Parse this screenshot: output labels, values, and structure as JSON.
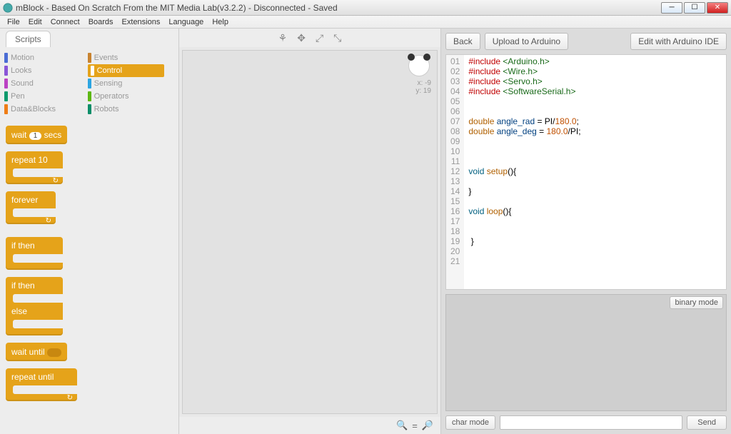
{
  "window": {
    "title": "mBlock - Based On Scratch From the MIT Media Lab(v3.2.2) - Disconnected - Saved"
  },
  "menu": [
    "File",
    "Edit",
    "Connect",
    "Boards",
    "Extensions",
    "Language",
    "Help"
  ],
  "tabs": {
    "scripts": "Scripts"
  },
  "categories": [
    {
      "name": "Motion",
      "color": "#4a6cd4"
    },
    {
      "name": "Events",
      "color": "#c88330"
    },
    {
      "name": "Looks",
      "color": "#8a55d7"
    },
    {
      "name": "Control",
      "color": "#e5a31a",
      "active": true
    },
    {
      "name": "Sound",
      "color": "#bb42c3"
    },
    {
      "name": "Sensing",
      "color": "#2ca5e2"
    },
    {
      "name": "Pen",
      "color": "#0e9a6c"
    },
    {
      "name": "Operators",
      "color": "#5cb712"
    },
    {
      "name": "Data&Blocks",
      "color": "#ee7d16"
    },
    {
      "name": "Robots",
      "color": "#0b8e69"
    }
  ],
  "blocks": {
    "wait_pre": "wait ",
    "wait_val": "1",
    "wait_post": " secs",
    "repeat_pre": "repeat ",
    "repeat_val": "10",
    "forever": "forever",
    "if_pre": "if ",
    "if_post": " then",
    "else": "else",
    "wait_until": "wait until ",
    "repeat_until": "repeat until "
  },
  "stage": {
    "x_label": "x: -9",
    "y_label": "y: 19"
  },
  "buttons": {
    "back": "Back",
    "upload": "Upload to Arduino",
    "edit_ide": "Edit with Arduino IDE",
    "bin_mode": "binary mode",
    "char_mode": "char mode",
    "send": "Send"
  },
  "code": {
    "lines": 21,
    "tokens": [
      [
        [
          "#include ",
          "kw-inc"
        ],
        [
          "<Arduino.h>",
          "kw-str"
        ]
      ],
      [
        [
          "#include ",
          "kw-inc"
        ],
        [
          "<Wire.h>",
          "kw-str"
        ]
      ],
      [
        [
          "#include ",
          "kw-inc"
        ],
        [
          "<Servo.h>",
          "kw-str"
        ]
      ],
      [
        [
          "#include ",
          "kw-inc"
        ],
        [
          "<SoftwareSerial.h>",
          "kw-str"
        ]
      ],
      [],
      [],
      [
        [
          "double ",
          "kw-type"
        ],
        [
          "angle_rad",
          "kw-var"
        ],
        [
          " = PI/",
          ""
        ],
        [
          "180.0",
          "kw-num"
        ],
        [
          ";",
          ""
        ]
      ],
      [
        [
          "double ",
          "kw-type"
        ],
        [
          "angle_deg",
          "kw-var"
        ],
        [
          " = ",
          ""
        ],
        [
          "180.0",
          "kw-num"
        ],
        [
          "/PI;",
          ""
        ]
      ],
      [],
      [],
      [],
      [
        [
          "void ",
          "kw-void"
        ],
        [
          "setup",
          "kw-type"
        ],
        [
          "(){",
          ""
        ]
      ],
      [],
      [
        [
          "}",
          ""
        ]
      ],
      [],
      [
        [
          "void ",
          "kw-void"
        ],
        [
          "loop",
          "kw-type"
        ],
        [
          "(){",
          ""
        ]
      ],
      [],
      [],
      [
        [
          " }",
          ""
        ]
      ],
      [],
      []
    ]
  }
}
